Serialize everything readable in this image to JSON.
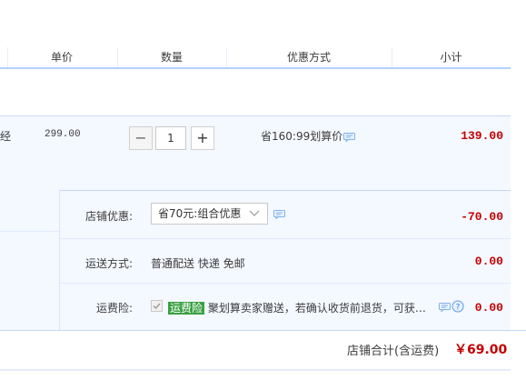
{
  "header": {
    "col_unit_price": "单价",
    "col_quantity": "数量",
    "col_discount": "优惠方式",
    "col_subtotal": "小计"
  },
  "item": {
    "title_fragment": "经",
    "unit_price": "299.00",
    "quantity": "1",
    "promo_text": "省160:99划算价",
    "subtotal": "139.00"
  },
  "shop": {
    "discount_label": "店铺优惠:",
    "discount_selected": "省70元:组合优惠",
    "discount_amount": "-70.00",
    "shipping_label": "运送方式:",
    "shipping_value": "普通配送 快递 免邮",
    "shipping_amount": "0.00",
    "insurance_label": "运费险:",
    "insurance_tag": "运费险",
    "insurance_text": "聚划算卖家赠送，若确认收货前退货，可获…",
    "insurance_amount": "0.00",
    "total_label": "店铺合计(含运费)",
    "total_amount": "￥69.00"
  },
  "colors": {
    "accent_blue": "#b2d1ff",
    "price_red": "#c40000",
    "tag_green": "#3aa142"
  }
}
